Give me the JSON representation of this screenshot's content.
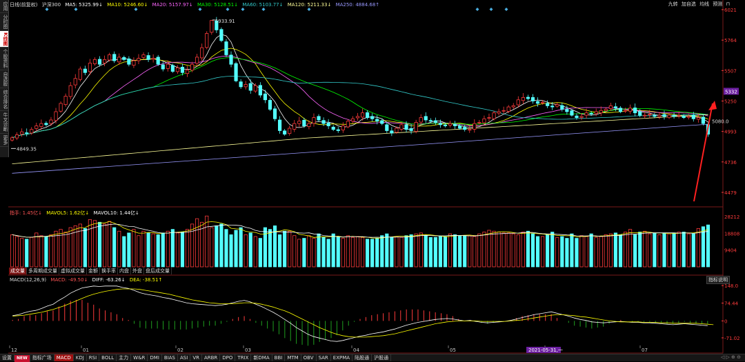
{
  "left_toolbar": {
    "items": [
      "应用",
      "分时图",
      "K线图",
      "个股资料",
      "自选股",
      "综合排名",
      "牛叉诊断",
      "更多"
    ],
    "active_index": 2
  },
  "legend_main": {
    "period": "日线(前复权)",
    "name": "沪深300",
    "ma5": "MA5: 5325.99↓",
    "ma10": "MA10: 5246.60↓",
    "ma20": "MA20: 5157.97↓",
    "ma30": "MA30: 5128.51↓",
    "ma60": "MA60: 5103.77↓",
    "ma120": "MA120: 5211.33↓",
    "ma250": "MA250: 4884.68↑"
  },
  "top_right_tools": [
    "九转",
    "加自选",
    "均线",
    "预测"
  ],
  "colors": {
    "up": "#ff3b3b",
    "down": "#54ffff",
    "ma5": "#ffffff",
    "ma10": "#ffff00",
    "ma20": "#ff66ff",
    "ma30": "#00ff00",
    "ma60": "#33cccc",
    "ma120": "#ffff99",
    "ma250": "#9999ff",
    "diff": "#ffffff",
    "dea": "#ffff00",
    "arrow": "#ff2020"
  },
  "legend_vol": {
    "label": "指手: 1.45亿↓",
    "mavol5": "MAVOL5: 1.62亿↓",
    "mavol10": "MAVOL10: 1.44亿↓"
  },
  "vol_tabs": [
    "成交量",
    "多周期成交量",
    "虚拟成交量",
    "金额",
    "换手率",
    "内盘",
    "外盘",
    "盘后成交量"
  ],
  "legend_macd": {
    "name": "MACD(12,26,9)",
    "macd": "MACD: -49.50↓",
    "diff": "DIFF: -63.26↓",
    "dea": "DEA: -38.51↑"
  },
  "macd_help": "指标说明",
  "date_labels": [
    "12",
    "01",
    "02",
    "03",
    "04",
    "05",
    "06",
    "07"
  ],
  "date_highlight": "2021-05-31,一",
  "bottom_tabs": [
    "设置",
    "NEW",
    "指标广场",
    "MACD",
    "KDJ",
    "RSI",
    "BOLL",
    "主力",
    "W&R",
    "DMI",
    "BIAS",
    "ASI",
    "VR",
    "ARBR",
    "DPO",
    "TRIX",
    "新DMA",
    "BBI",
    "MTM",
    "OBV",
    "SAR",
    "EXPMA",
    "陆股通",
    "沪股通"
  ],
  "bottom_active": "MACD",
  "bottom_right": "◁ ▷ ⊕ ⊖",
  "chart_data": [
    {
      "type": "candlestick",
      "panel": "price",
      "x_range": [
        "2020-12",
        "2021-07"
      ],
      "ylim": [
        4380,
        6021
      ],
      "y_ticks": [
        "6021",
        "5764",
        "5507",
        "5250",
        "4993",
        "4736",
        "4479"
      ],
      "price_tag": "5332",
      "annotations": {
        "high": "5933.91",
        "low": "4849.35",
        "last_marker": "5080.0"
      },
      "close": [
        4940,
        4965,
        4990,
        4980,
        5010,
        5040,
        5060,
        5050,
        5090,
        5160,
        5230,
        5290,
        5380,
        5440,
        5520,
        5490,
        5570,
        5600,
        5560,
        5600,
        5640,
        5590,
        5620,
        5600,
        5560,
        5590,
        5610,
        5640,
        5600,
        5610,
        5560,
        5520,
        5560,
        5500,
        5530,
        5490,
        5510,
        5560,
        5620,
        5700,
        5820,
        5930,
        5850,
        5760,
        5640,
        5560,
        5420,
        5370,
        5390,
        5340,
        5380,
        5300,
        5260,
        5180,
        5100,
        5000,
        4970,
        5020,
        5060,
        5080,
        5040,
        5060,
        5110,
        5090,
        5060,
        5040,
        5010,
        5000,
        5040,
        5080,
        5100,
        5120,
        5150,
        5110,
        5100,
        5080,
        5060,
        5000,
        4980,
        5020,
        5050,
        5010,
        5000,
        5070,
        5110,
        5090,
        5080,
        5070,
        5050,
        5040,
        5060,
        5040,
        5020,
        5010,
        5010,
        5060,
        5070,
        5100,
        5110,
        5150,
        5160,
        5170,
        5200,
        5210,
        5260,
        5280,
        5270,
        5250,
        5230,
        5240,
        5210,
        5200,
        5220,
        5180,
        5160,
        5130,
        5110,
        5120,
        5150,
        5140,
        5160,
        5170,
        5180,
        5210,
        5190,
        5160,
        5170,
        5190,
        5150,
        5130,
        5130,
        5140,
        5120,
        5130,
        5120,
        5130,
        5120,
        5130,
        5110,
        5120,
        5100,
        5110,
        5060,
        4970
      ]
    },
    {
      "type": "bar",
      "panel": "volume",
      "ylim": [
        0,
        28212
      ],
      "y_ticks": [
        "28212",
        "18808",
        "9404"
      ],
      "values": [
        18000,
        17000,
        16000,
        15500,
        16500,
        19000,
        17500,
        17000,
        18000,
        20000,
        21000,
        19500,
        22000,
        23000,
        24000,
        21500,
        26500,
        26000,
        25000,
        24000,
        25500,
        22000,
        20000,
        17000,
        19000,
        21000,
        17500,
        20000,
        19000,
        18500,
        18000,
        19000,
        20000,
        21000,
        19000,
        19500,
        21000,
        24000,
        27000,
        25000,
        28500,
        22000,
        23000,
        24000,
        21000,
        18000,
        20500,
        22000,
        18000,
        19000,
        17000,
        16000,
        22000,
        21000,
        23000,
        18000,
        20000,
        20000,
        17500,
        15500,
        16000,
        17500,
        16000,
        18500,
        16500,
        15500,
        18500,
        17000,
        16000,
        17500,
        16500,
        17000,
        16500,
        15500,
        15500,
        16000,
        17500,
        18500,
        16500,
        17000,
        16500,
        17500,
        18000,
        18500,
        19000,
        17500,
        16500,
        16500,
        17000,
        17000,
        18500,
        18000,
        17500,
        17500,
        17500,
        17000,
        18500,
        19500,
        20500,
        20000,
        19500,
        19000,
        19000,
        18500,
        18000,
        19500,
        20000,
        18500,
        17000,
        17000,
        18000,
        19500,
        16500,
        17000,
        16000,
        18500,
        16000,
        17500,
        17000,
        18500,
        16500,
        17000,
        18000,
        18500,
        19000,
        18000,
        19500,
        21000,
        18000,
        19500,
        20000,
        18500,
        19000,
        18000,
        19000,
        18500,
        19000,
        19500,
        19500,
        18500,
        18500,
        21500,
        22500,
        23500
      ]
    },
    {
      "type": "line",
      "panel": "macd",
      "ylim": [
        -100,
        160
      ],
      "y_ticks": [
        "148.0",
        "74.44",
        "0",
        "-71.02"
      ],
      "series": [
        {
          "name": "DIFF",
          "values": [
            22,
            26,
            34,
            40,
            44,
            52,
            62,
            70,
            86,
            100,
            116,
            128,
            138,
            142,
            146,
            144,
            146,
            146,
            146,
            140,
            136,
            128,
            118,
            112,
            108,
            104,
            98,
            94,
            88,
            82,
            76,
            72,
            70,
            68,
            66,
            64,
            66,
            70,
            76,
            82,
            86,
            80,
            70,
            60,
            48,
            36,
            22,
            6,
            -10,
            -28,
            -42,
            -56,
            -66,
            -72,
            -78,
            -84,
            -86,
            -82,
            -76,
            -70,
            -64,
            -60,
            -54,
            -50,
            -46,
            -40,
            -34,
            -26,
            -18,
            -12,
            -6,
            -2,
            2,
            6,
            8,
            10,
            8,
            4,
            0,
            2,
            -2,
            -6,
            -8,
            -6,
            -4,
            -2,
            2,
            8,
            14,
            20,
            26,
            30,
            34,
            38,
            32,
            26,
            20,
            12,
            6,
            2,
            -4,
            -6,
            -8,
            -6,
            -4,
            -2,
            -4,
            -6,
            -6,
            -8,
            -8,
            -10,
            -12,
            -14,
            -16,
            -14,
            -12,
            -14,
            -16,
            -18,
            -20
          ]
        },
        {
          "name": "DEA",
          "values": [
            20,
            22,
            24,
            28,
            32,
            36,
            42,
            48,
            56,
            64,
            74,
            84,
            94,
            104,
            112,
            118,
            124,
            128,
            132,
            134,
            134,
            134,
            132,
            128,
            124,
            120,
            116,
            112,
            106,
            100,
            94,
            88,
            84,
            80,
            76,
            74,
            72,
            72,
            72,
            74,
            76,
            76,
            74,
            70,
            64,
            58,
            50,
            42,
            32,
            20,
            8,
            -4,
            -16,
            -28,
            -38,
            -48,
            -56,
            -62,
            -66,
            -68,
            -68,
            -68,
            -66,
            -64,
            -62,
            -58,
            -54,
            -48,
            -42,
            -36,
            -30,
            -24,
            -18,
            -12,
            -8,
            -4,
            -2,
            0,
            0,
            0,
            0,
            -2,
            -2,
            -2,
            -2,
            -2,
            0,
            2,
            4,
            8,
            12,
            16,
            20,
            24,
            26,
            26,
            24,
            22,
            18,
            16,
            12,
            8,
            4,
            0,
            -2,
            -4,
            -4,
            -4,
            -4,
            -6,
            -6,
            -6,
            -8,
            -8,
            -10,
            -10,
            -10,
            -10,
            -10,
            -12,
            -14,
            -16
          ]
        }
      ]
    }
  ]
}
